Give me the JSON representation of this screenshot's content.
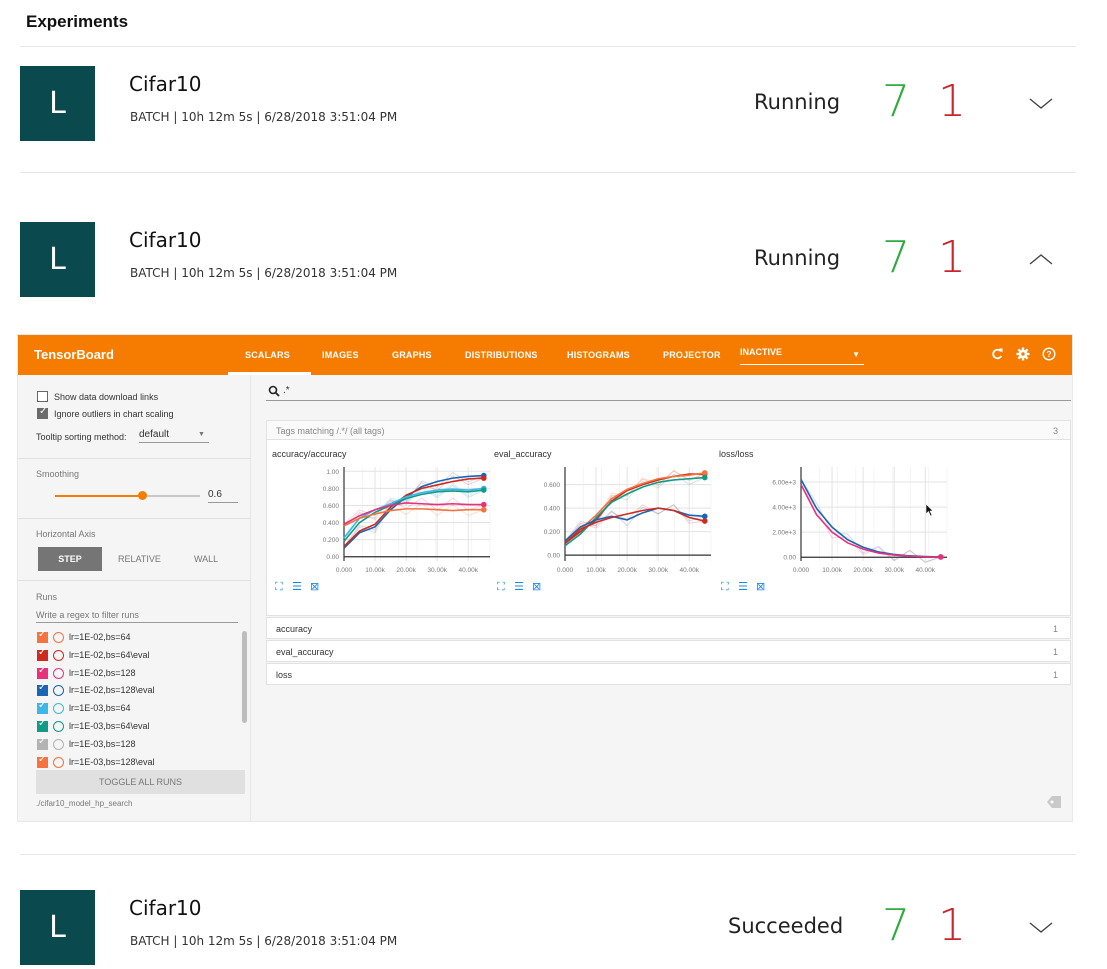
{
  "page_title": "Experiments",
  "experiments": [
    {
      "tile_letter": "L",
      "name": "Cifar10",
      "meta": "BATCH  |  10h 12m 5s  | 6/28/2018 3:51:04 PM",
      "status": "Running",
      "ok_count": "7",
      "fail_count": "1",
      "chevron": "chevron-down-icon"
    },
    {
      "tile_letter": "L",
      "name": "Cifar10",
      "meta": "BATCH  |  10h 12m 5s  | 6/28/2018 3:51:04 PM",
      "status": "Running",
      "ok_count": "7",
      "fail_count": "1",
      "chevron": "chevron-up-icon"
    },
    {
      "tile_letter": "L",
      "name": "Cifar10",
      "meta": "BATCH  |  10h 12m 5s  | 6/28/2018 3:51:04 PM",
      "status": "Succeeded",
      "ok_count": "7",
      "fail_count": "1",
      "chevron": "chevron-down-icon"
    }
  ],
  "colors": {
    "tile": "#0a4a4f",
    "ok": "#2eaa3e",
    "fail": "#c9252b",
    "tb_orange": "#f57c00"
  },
  "tensorboard": {
    "brand": "TensorBoard",
    "tabs": [
      "SCALARS",
      "IMAGES",
      "GRAPHS",
      "DISTRIBUTIONS",
      "HISTOGRAMS",
      "PROJECTOR"
    ],
    "active_tab": "SCALARS",
    "inactive_select": "INACTIVE",
    "icons": [
      "refresh-icon",
      "settings-icon",
      "help-icon"
    ],
    "sidebar": {
      "show_download_links": "Show data download links",
      "ignore_outliers": "Ignore outliers in chart scaling",
      "tooltip_label": "Tooltip sorting method:",
      "tooltip_value": "default",
      "smoothing_label": "Smoothing",
      "smoothing_value": "0.6",
      "horizontal_axis_label": "Horizontal Axis",
      "axis_options": [
        "STEP",
        "RELATIVE",
        "WALL"
      ],
      "runs_label": "Runs",
      "runs_filter_placeholder": "Write a regex to filter runs",
      "runs": [
        {
          "label": "lr=1E-02,bs=64",
          "color": "#f4733e"
        },
        {
          "label": "lr=1E-02,bs=64\\eval",
          "color": "#cf2a1f"
        },
        {
          "label": "lr=1E-02,bs=128",
          "color": "#e8317a"
        },
        {
          "label": "lr=1E-02,bs=128\\eval",
          "color": "#1a64b5"
        },
        {
          "label": "lr=1E-03,bs=64",
          "color": "#3fb6e8"
        },
        {
          "label": "lr=1E-03,bs=64\\eval",
          "color": "#119b87"
        },
        {
          "label": "lr=1E-03,bs=128",
          "color": "#b3b3b3"
        },
        {
          "label": "lr=1E-03,bs=128\\eval",
          "color": "#f4733e"
        }
      ],
      "toggle_all": "TOGGLE ALL RUNS",
      "logdir": "./cifar10_model_hp_search"
    },
    "search_query": ".*",
    "tags_header": "Tags matching /.*/ (all tags)",
    "tags_count": "3",
    "sections": [
      {
        "name": "accuracy",
        "count": "1"
      },
      {
        "name": "eval_accuracy",
        "count": "1"
      },
      {
        "name": "loss",
        "count": "1"
      }
    ]
  },
  "chart_data": [
    {
      "type": "line",
      "title": "accuracy/accuracy",
      "xlabel": "",
      "ylabel": "",
      "xlim": [
        0,
        47000
      ],
      "ylim": [
        -0.05,
        1.05
      ],
      "x_ticks": [
        "0.000",
        "10.00k",
        "20.00k",
        "30.00k",
        "40.00k"
      ],
      "y_ticks": [
        "1.00",
        "0.800",
        "0.600",
        "0.400",
        "0.200",
        "0.00"
      ],
      "x": [
        0,
        5000,
        10000,
        15000,
        20000,
        25000,
        30000,
        35000,
        40000,
        45000
      ],
      "series": [
        {
          "color": "#1a64b5",
          "values": [
            0.1,
            0.28,
            0.35,
            0.55,
            0.7,
            0.82,
            0.88,
            0.92,
            0.94,
            0.95
          ]
        },
        {
          "color": "#cf2a1f",
          "values": [
            0.12,
            0.3,
            0.38,
            0.58,
            0.72,
            0.8,
            0.84,
            0.88,
            0.91,
            0.92
          ]
        },
        {
          "color": "#3fb6e8",
          "values": [
            0.22,
            0.45,
            0.55,
            0.62,
            0.7,
            0.75,
            0.78,
            0.79,
            0.78,
            0.8
          ]
        },
        {
          "color": "#119b87",
          "values": [
            0.18,
            0.4,
            0.52,
            0.6,
            0.68,
            0.73,
            0.76,
            0.77,
            0.76,
            0.78
          ]
        },
        {
          "color": "#e8317a",
          "values": [
            0.38,
            0.48,
            0.55,
            0.6,
            0.63,
            0.62,
            0.61,
            0.62,
            0.61,
            0.61
          ]
        },
        {
          "color": "#f4733e",
          "values": [
            0.36,
            0.45,
            0.5,
            0.54,
            0.56,
            0.56,
            0.55,
            0.54,
            0.55,
            0.55
          ]
        }
      ]
    },
    {
      "type": "line",
      "title": "eval_accuracy",
      "xlabel": "",
      "ylabel": "",
      "xlim": [
        0,
        47000
      ],
      "ylim": [
        -0.05,
        0.75
      ],
      "x_ticks": [
        "0.000",
        "10.00k",
        "20.00k",
        "30.00k",
        "40.00k"
      ],
      "y_ticks": [
        "0.600",
        "0.400",
        "0.200",
        "0.00"
      ],
      "x": [
        0,
        5000,
        10000,
        15000,
        20000,
        25000,
        30000,
        35000,
        40000,
        45000
      ],
      "series": [
        {
          "color": "#cf2a1f",
          "values": [
            0.1,
            0.2,
            0.3,
            0.46,
            0.55,
            0.6,
            0.64,
            0.67,
            0.69,
            0.69
          ]
        },
        {
          "color": "#f4733e",
          "values": [
            0.12,
            0.22,
            0.34,
            0.48,
            0.56,
            0.61,
            0.65,
            0.67,
            0.68,
            0.7
          ]
        },
        {
          "color": "#119b87",
          "values": [
            0.08,
            0.18,
            0.32,
            0.45,
            0.52,
            0.58,
            0.62,
            0.64,
            0.65,
            0.66
          ]
        },
        {
          "color": "#1a64b5",
          "values": [
            0.12,
            0.24,
            0.3,
            0.33,
            0.3,
            0.36,
            0.4,
            0.38,
            0.34,
            0.33
          ]
        },
        {
          "color": "#cf2a1f",
          "values": [
            0.1,
            0.22,
            0.28,
            0.32,
            0.35,
            0.38,
            0.4,
            0.38,
            0.32,
            0.29
          ]
        }
      ]
    },
    {
      "type": "line",
      "title": "loss/loss",
      "xlabel": "",
      "ylabel": "",
      "xlim": [
        0,
        47000
      ],
      "ylim": [
        -300,
        7200
      ],
      "x_ticks": [
        "0.000",
        "10.00k",
        "20.00k",
        "30.00k",
        "40.00k"
      ],
      "y_ticks": [
        "6.00e+3",
        "4.00e+3",
        "2.00e+3",
        "0.00"
      ],
      "x": [
        0,
        5000,
        10000,
        15000,
        20000,
        25000,
        30000,
        35000,
        40000,
        45000
      ],
      "series": [
        {
          "color": "#1a64b5",
          "values": [
            6200,
            3900,
            2400,
            1400,
            800,
            420,
            220,
            110,
            60,
            30
          ]
        },
        {
          "color": "#e8317a",
          "values": [
            5800,
            3400,
            2000,
            1150,
            650,
            330,
            170,
            90,
            40,
            20
          ]
        }
      ]
    }
  ]
}
